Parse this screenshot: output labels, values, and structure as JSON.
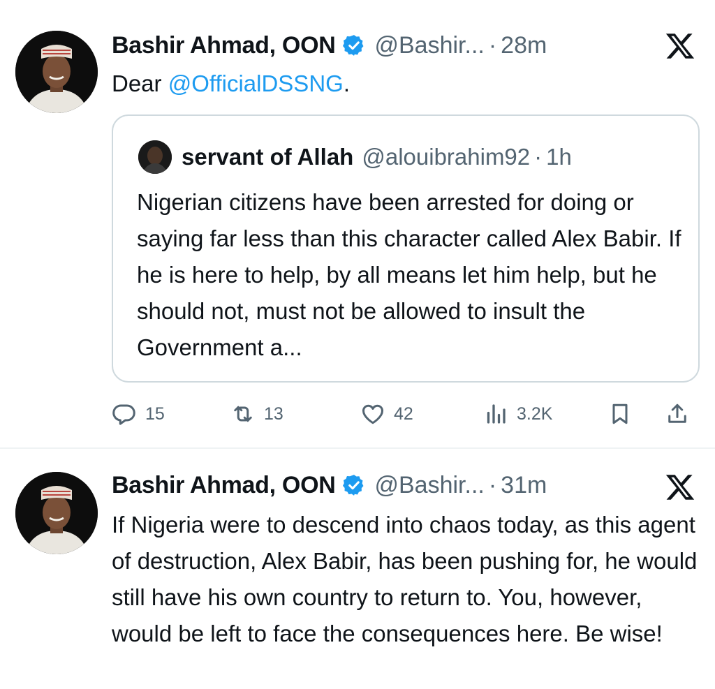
{
  "tweets": [
    {
      "author": {
        "name": "Bashir Ahmad, OON",
        "handle": "@Bashir...",
        "verified": true,
        "avatar_icon": "profile-photo"
      },
      "time": "28m",
      "separator": "·",
      "text_prefix": "Dear ",
      "mention": "@OfficialDSSNG",
      "text_suffix": ".",
      "quote": {
        "name": "servant of Allah",
        "handle": "@alouibrahim92",
        "separator": "·",
        "time": "1h",
        "text": "Nigerian citizens have been arrested for doing or saying far less than this character called Alex Babir. If he is here to help, by all means let him help, but he should not, must not be allowed to insult the Government a..."
      },
      "actions": {
        "replies": "15",
        "reposts": "13",
        "likes": "42",
        "views": "3.2K"
      }
    },
    {
      "author": {
        "name": "Bashir Ahmad, OON",
        "handle": "@Bashir...",
        "verified": true,
        "avatar_icon": "profile-photo"
      },
      "time": "31m",
      "separator": "·",
      "text": "If Nigeria were to descend into chaos today, as this agent of destruction, Alex Babir, has been pushing for, he would still have his own country to return to. You, however, would be left to face the consequences here. Be wise!"
    }
  ],
  "colors": {
    "text": "#0f1419",
    "secondary": "#536471",
    "link": "#1d9bf0",
    "verified": "#1d9bf0",
    "border": "#cfd9de"
  },
  "icons": [
    "x-logo-icon",
    "verified-badge-icon",
    "reply-icon",
    "repost-icon",
    "like-icon",
    "views-icon",
    "bookmark-icon",
    "share-icon"
  ]
}
